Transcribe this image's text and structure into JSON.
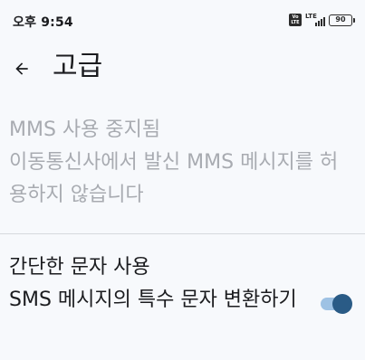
{
  "status_bar": {
    "time": "오후 9:54",
    "volte_line1": "Vo",
    "volte_line2": "LTE",
    "network": "LTE",
    "battery": "90"
  },
  "app_bar": {
    "title": "고급",
    "back_icon": "arrow-back-icon"
  },
  "preferences": {
    "mms": {
      "title": "MMS 사용 중지됨",
      "summary": "이동통신사에서 발신 MMS 메시지를 허용하지 않습니다",
      "enabled": false
    },
    "simple_chars": {
      "title": "간단한 문자 사용",
      "summary": "SMS 메시지의 특수 문자 변환하기",
      "checked": true
    }
  },
  "colors": {
    "background": "#f7f9fc",
    "switch_thumb": "#2a5b86",
    "switch_track": "#9ec2e4",
    "disabled_text": "#a8abb1"
  }
}
